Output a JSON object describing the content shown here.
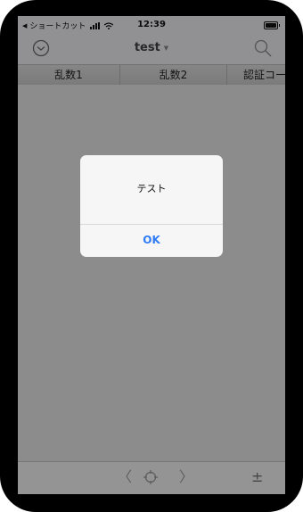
{
  "status_bar": {
    "back_label": "ショートカット",
    "time": "12:39"
  },
  "nav": {
    "title": "test",
    "left_icon": "chevron-down-circle-icon",
    "right_icon": "search-icon"
  },
  "table": {
    "columns": [
      "乱数1",
      "乱数2",
      "認証コード"
    ]
  },
  "alert": {
    "message": "テスト",
    "ok_label": "OK"
  },
  "toolbar": {
    "back_icon": "chevron-left-icon",
    "center_icon": "crosshair-icon",
    "forward_icon": "chevron-right-icon",
    "plusminus_label": "±"
  },
  "colors": {
    "accent": "#2f7cf6",
    "overlay": "rgba(0,0,0,0.40)"
  }
}
